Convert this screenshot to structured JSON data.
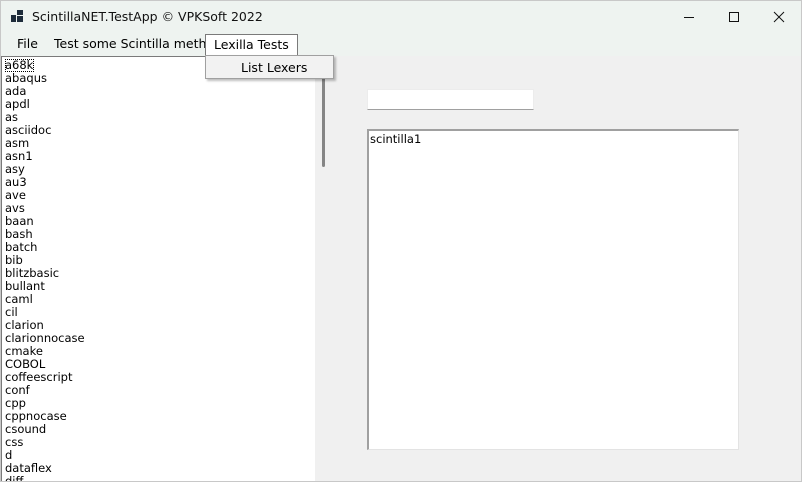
{
  "window": {
    "title": "ScintillaNET.TestApp  © VPKSoft 2022",
    "icon": "app-window-icon",
    "controls": {
      "minimize": "minimize-icon",
      "maximize": "maximize-icon",
      "close": "close-icon"
    }
  },
  "menubar": {
    "file": "File",
    "test_method": "Test some Scintilla method",
    "lexilla": "Lexilla Tests"
  },
  "dropdown": {
    "items": [
      "List Lexers"
    ]
  },
  "lexer_list": {
    "items": [
      "a68k",
      "abaqus",
      "ada",
      "apdl",
      "as",
      "asciidoc",
      "asm",
      "asn1",
      "asy",
      "au3",
      "ave",
      "avs",
      "baan",
      "bash",
      "batch",
      "bib",
      "blitzbasic",
      "bullant",
      "caml",
      "cil",
      "clarion",
      "clarionnocase",
      "cmake",
      "COBOL",
      "coffeescript",
      "conf",
      "cpp",
      "cppnocase",
      "csound",
      "css",
      "d",
      "dataflex",
      "diff"
    ]
  },
  "textbox": {
    "value": ""
  },
  "scintilla": {
    "text": "scintilla1"
  }
}
